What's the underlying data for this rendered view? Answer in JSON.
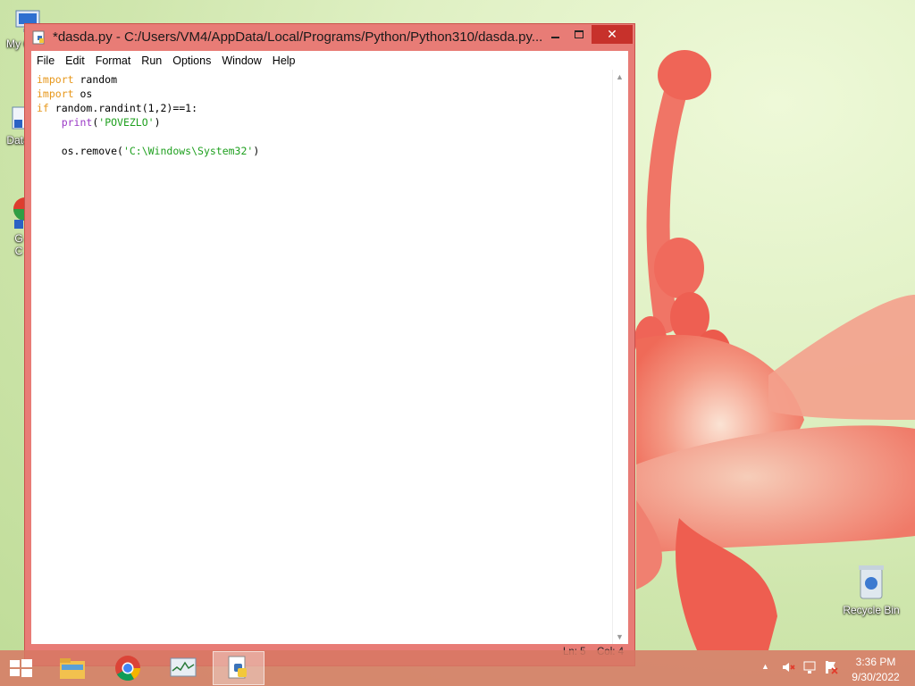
{
  "window": {
    "title": "*dasda.py - C:/Users/VM4/AppData/Local/Programs/Python/Python310/dasda.py...",
    "minimize_icon": "minimize-icon",
    "maximize_icon": "maximize-icon",
    "close_icon": "close-icon"
  },
  "menu": [
    "File",
    "Edit",
    "Format",
    "Run",
    "Options",
    "Window",
    "Help"
  ],
  "editor": {
    "lines": [
      "import random",
      "import os",
      "if random.randint(1,2)==1:",
      "    print('POVEZLO')",
      "",
      "    os.remove('C:\\Windows\\System32')"
    ]
  },
  "status": {
    "line": "Ln: 5",
    "col": "Col: 4"
  },
  "desktop_icons": [
    {
      "label": "My C",
      "icon": "computer-icon"
    },
    {
      "label": "Data",
      "icon": "shortcut-icon"
    },
    {
      "label": "G\nC",
      "icon": "chrome-icon"
    },
    {
      "label": "Recycle Bin",
      "icon": "recycle-bin-icon"
    }
  ],
  "taskbar": {
    "apps": [
      "file-explorer-icon",
      "chrome-icon",
      "resource-monitor-icon",
      "python-idle-icon"
    ],
    "active_app": "python-idle-icon"
  },
  "tray": {
    "time": "3:36 PM",
    "date": "9/30/2022",
    "icons": [
      "show-hidden-icon",
      "volume-muted-icon",
      "network-icon",
      "action-center-icon"
    ]
  },
  "colors": {
    "window_frame": "#e87c76",
    "close_button": "#c7312b",
    "keyword": "#e7971a",
    "builtin": "#9a38c6",
    "string": "#1fa01f"
  }
}
